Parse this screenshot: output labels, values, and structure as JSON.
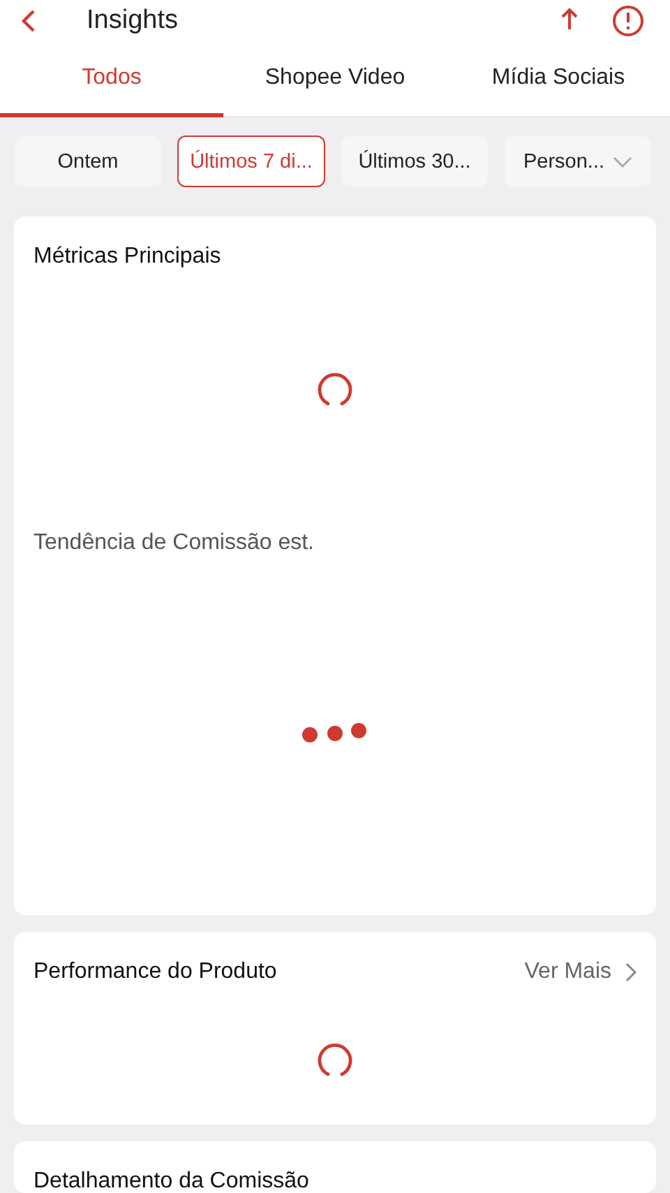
{
  "header": {
    "title": "Insights"
  },
  "tabs": [
    {
      "label": "Todos",
      "selected": true
    },
    {
      "label": "Shopee Video",
      "selected": false
    },
    {
      "label": "Mídia Sociais",
      "selected": false
    }
  ],
  "filters": [
    {
      "label": "Ontem",
      "selected": false,
      "dropdown": false
    },
    {
      "label": "Últimos 7 di...",
      "selected": true,
      "dropdown": false
    },
    {
      "label": "Últimos 30...",
      "selected": false,
      "dropdown": false
    },
    {
      "label": "Person...",
      "selected": false,
      "dropdown": true
    }
  ],
  "cards": [
    {
      "kind": "metrics",
      "title": "Métricas Principais",
      "subtitle": "Tendência de Comissão est."
    },
    {
      "kind": "performance",
      "title": "Performance do Produto",
      "link": "Ver Mais"
    },
    {
      "kind": "commission",
      "title": "Detalhamento da Comissão"
    }
  ]
}
